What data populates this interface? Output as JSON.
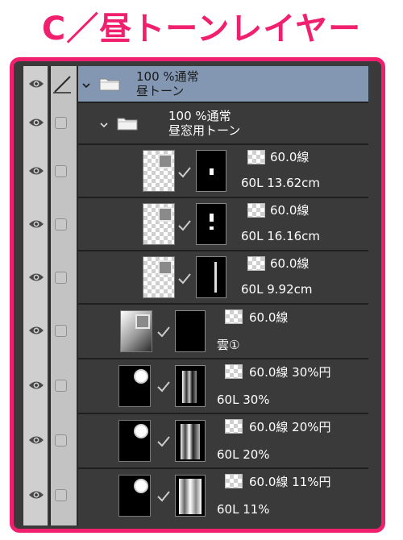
{
  "title": "C／昼トーンレイヤー",
  "colors": {
    "accent": "#f0206f",
    "panel": "#3a3a3a",
    "selected_row": "#8397b2"
  },
  "layers": [
    {
      "kind": "folder",
      "opacity_blend": "100 %通常",
      "name": "昼トーン",
      "selected": true,
      "editable": true
    },
    {
      "kind": "folder",
      "opacity_blend": "100 %通常",
      "name": "昼窓用トーン",
      "selected": false
    },
    {
      "kind": "tone",
      "tone": "60.0線",
      "name": "60L 13.62cm"
    },
    {
      "kind": "tone",
      "tone": "60.0線",
      "name": "60L 16.16cm"
    },
    {
      "kind": "tone",
      "tone": "60.0線",
      "name": "60L 9.92cm"
    },
    {
      "kind": "tone",
      "tone": "60.0線",
      "name": "雲①"
    },
    {
      "kind": "tone",
      "tone": "60.0線 30%円",
      "name": "60L 30%"
    },
    {
      "kind": "tone",
      "tone": "60.0線 20%円",
      "name": "60L 20%"
    },
    {
      "kind": "tone",
      "tone": "60.0線 11%円",
      "name": "60L 11%"
    }
  ],
  "icons": {
    "visibility": "eye-icon",
    "edit": "pencil-icon",
    "expand": "chevron-down-icon",
    "folder": "folder-icon",
    "tone": "tone-icon",
    "check": "checkmark-icon"
  }
}
